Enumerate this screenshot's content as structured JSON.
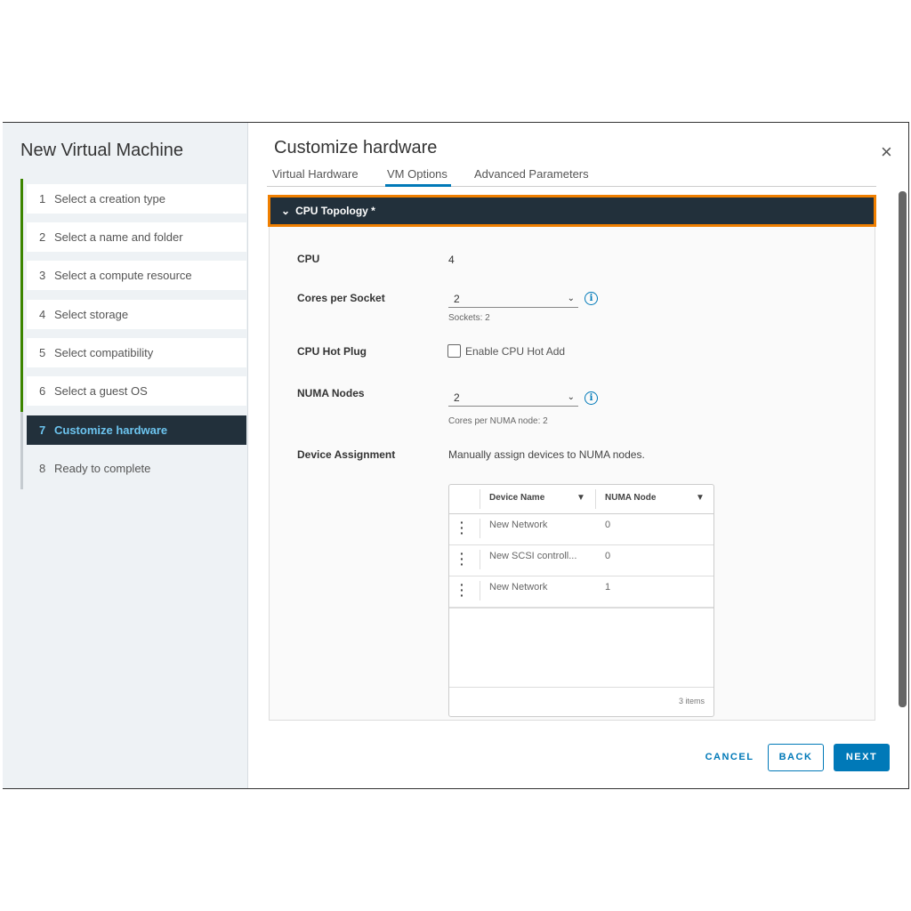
{
  "wizard": {
    "title": "New Virtual Machine",
    "steps": [
      {
        "num": "1",
        "label": "Select a creation type"
      },
      {
        "num": "2",
        "label": "Select a name and folder"
      },
      {
        "num": "3",
        "label": "Select a compute resource"
      },
      {
        "num": "4",
        "label": "Select storage"
      },
      {
        "num": "5",
        "label": "Select compatibility"
      },
      {
        "num": "6",
        "label": "Select a guest OS"
      },
      {
        "num": "7",
        "label": "Customize hardware"
      },
      {
        "num": "8",
        "label": "Ready to complete"
      }
    ]
  },
  "page": {
    "title": "Customize hardware",
    "close": "×",
    "tabs": [
      "Virtual Hardware",
      "VM Options",
      "Advanced Parameters"
    ],
    "section": {
      "chevron": "⌄",
      "title": "CPU Topology *"
    }
  },
  "form": {
    "cpu": {
      "label": "CPU",
      "value": "4"
    },
    "cores": {
      "label": "Cores per Socket",
      "value": "2",
      "hint": "Sockets: 2"
    },
    "hotplug": {
      "label": "CPU Hot Plug",
      "checkbox": "Enable CPU Hot Add",
      "checked": false
    },
    "numa": {
      "label": "NUMA Nodes",
      "value": "2",
      "hint": "Cores per NUMA node: 2"
    },
    "device": {
      "label": "Device Assignment",
      "desc": "Manually assign devices to NUMA nodes."
    }
  },
  "table": {
    "headers": [
      "Device Name",
      "NUMA Node"
    ],
    "rows": [
      {
        "name": "New Network",
        "node": "0"
      },
      {
        "name": "New SCSI controll...",
        "node": "0"
      },
      {
        "name": "New Network",
        "node": "1"
      }
    ],
    "footer": "3 items"
  },
  "buttons": {
    "cancel": "CANCEL",
    "back": "BACK",
    "next": "NEXT"
  },
  "colors": {
    "accent": "#0079b8",
    "highlight": "#f07f00",
    "header": "#22303b",
    "complete": "#3c8500"
  }
}
